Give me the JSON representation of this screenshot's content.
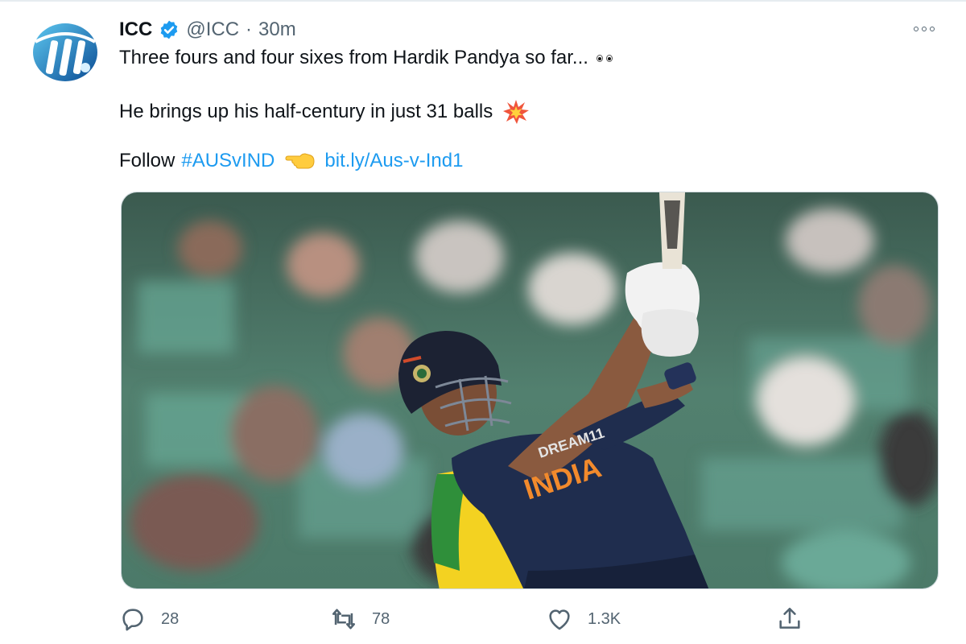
{
  "tweet": {
    "author_name": "ICC",
    "handle": "@ICC",
    "separator": "·",
    "time": "30m",
    "line1": "Three fours and four sixes from Hardik Pandya so far...",
    "line2": "He brings up his half-century in just 31 balls",
    "follow_label": "Follow",
    "hashtag": "#AUSvIND",
    "link": "bit.ly/Aus-v-Ind1",
    "media": {
      "jersey_text": "INDIA"
    }
  },
  "icons": {
    "avatar": "icc-logo-icon",
    "verified": "verified-badge-icon",
    "more": "more-options-icon",
    "eyes": "eyes-emoji-icon",
    "collision": "collision-emoji-icon",
    "pointing": "backhand-index-pointing-left-emoji-icon",
    "reply": "reply-icon",
    "retweet": "retweet-icon",
    "like": "heart-icon",
    "share": "share-icon"
  },
  "actions": {
    "replies": "28",
    "retweets": "78",
    "likes": "1.3K"
  },
  "colors": {
    "link_blue": "#1d9bf0",
    "text_primary": "#0f1419",
    "text_secondary": "#536471",
    "icc_blue": "#1b72b8"
  }
}
